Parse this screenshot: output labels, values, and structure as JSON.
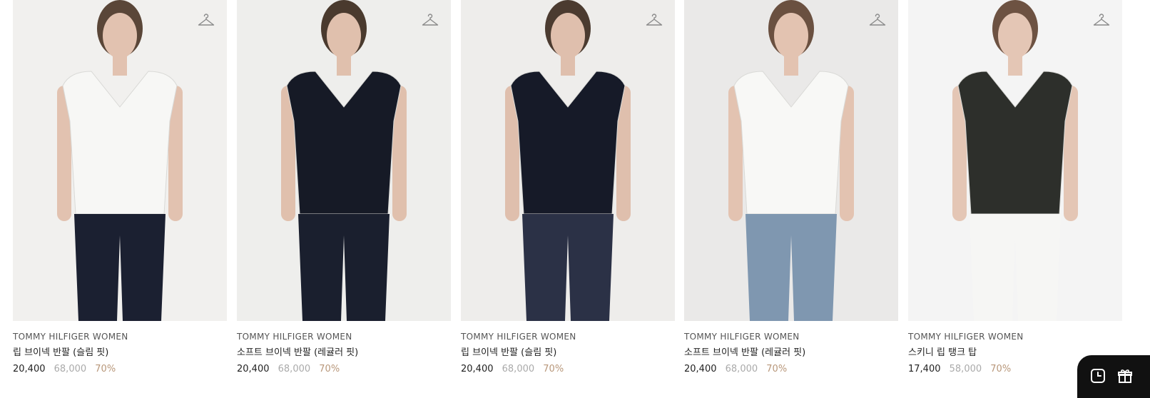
{
  "products": [
    {
      "brand": "TOMMY HILFIGER WOMEN",
      "name": "립 브이넥 반팔 (슬림 핏)",
      "sale_price": "20,400",
      "original_price": "68,000",
      "discount": "70%",
      "bg": "#ecebe9",
      "top": "#f7f7f5",
      "bottom": "#1b2031",
      "skin": "#e2c2b0",
      "hair": "#5a4638"
    },
    {
      "brand": "TOMMY HILFIGER WOMEN",
      "name": "소프트 브이넥 반팔 (레귤러 핏)",
      "sale_price": "20,400",
      "original_price": "68,000",
      "discount": "70%",
      "bg": "#e9e8e6",
      "top": "#161a26",
      "bottom": "#1a1f2e",
      "skin": "#e0c0ad",
      "hair": "#4a3a2e"
    },
    {
      "brand": "TOMMY HILFIGER WOMEN",
      "name": "립 브이넥 반팔 (슬림 핏)",
      "sale_price": "20,400",
      "original_price": "68,000",
      "discount": "70%",
      "bg": "#e8e7e5",
      "top": "#161a28",
      "bottom": "#2b3146",
      "skin": "#dfbfad",
      "hair": "#4b3b30"
    },
    {
      "brand": "TOMMY HILFIGER WOMEN",
      "name": "소프트 브이넥 반팔 (레귤러 핏)",
      "sale_price": "20,400",
      "original_price": "68,000",
      "discount": "70%",
      "bg": "#e3e2e0",
      "top": "#f8f8f6",
      "bottom": "#7f97b0",
      "skin": "#e3c3b1",
      "hair": "#6a5040"
    },
    {
      "brand": "TOMMY HILFIGER WOMEN",
      "name": "스키니 립 탱크 탑",
      "sale_price": "17,400",
      "original_price": "58,000",
      "discount": "70%",
      "bg": "#f1f1f0",
      "top": "#2d2f2b",
      "bottom": "#f6f6f4",
      "skin": "#e4c6b5",
      "hair": "#6d5242"
    }
  ],
  "icons": {
    "wishlist": "hanger-icon",
    "recent": "clock-icon",
    "gift": "gift-icon"
  },
  "colors": {
    "discount": "#b8977a",
    "original_price": "#aaaaaa",
    "floating_bg": "#111111"
  }
}
